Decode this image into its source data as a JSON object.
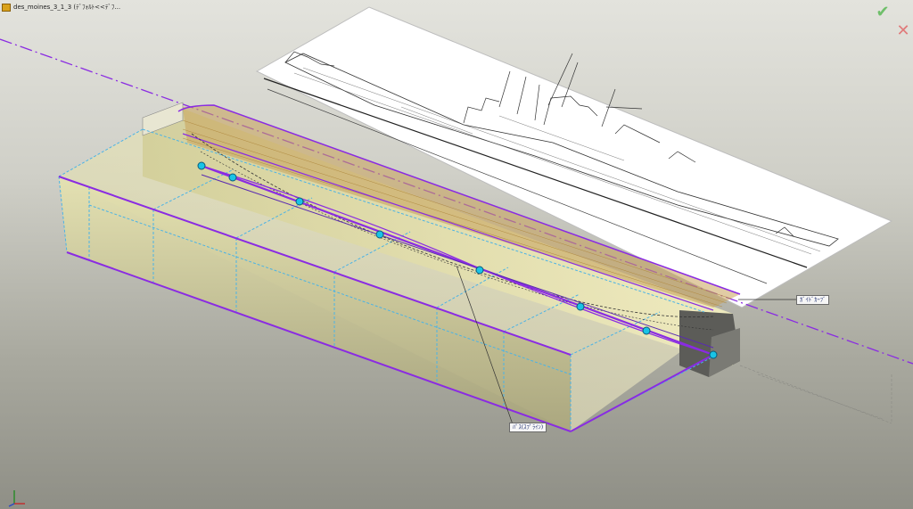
{
  "window": {
    "document_tab": "des_moines_3_1_3 (ﾃﾞﾌｫﾙﾄ<<ﾃﾞﾌ..."
  },
  "confirm_corner": {
    "ok_label": "✔",
    "cancel_label": "✕"
  },
  "callouts": {
    "guide_curve": "ｶﾞｲﾄﾞｶｰﾌﾞ",
    "path": "ﾊﾟｽ(ｽﾌﾟﾗｲﾝ)"
  },
  "colors": {
    "construction_purple": "#8a2be2",
    "sketch_blue": "#4ab3e6",
    "face_yellow": "#d9d59a",
    "point_cyan": "#19c3e6"
  }
}
